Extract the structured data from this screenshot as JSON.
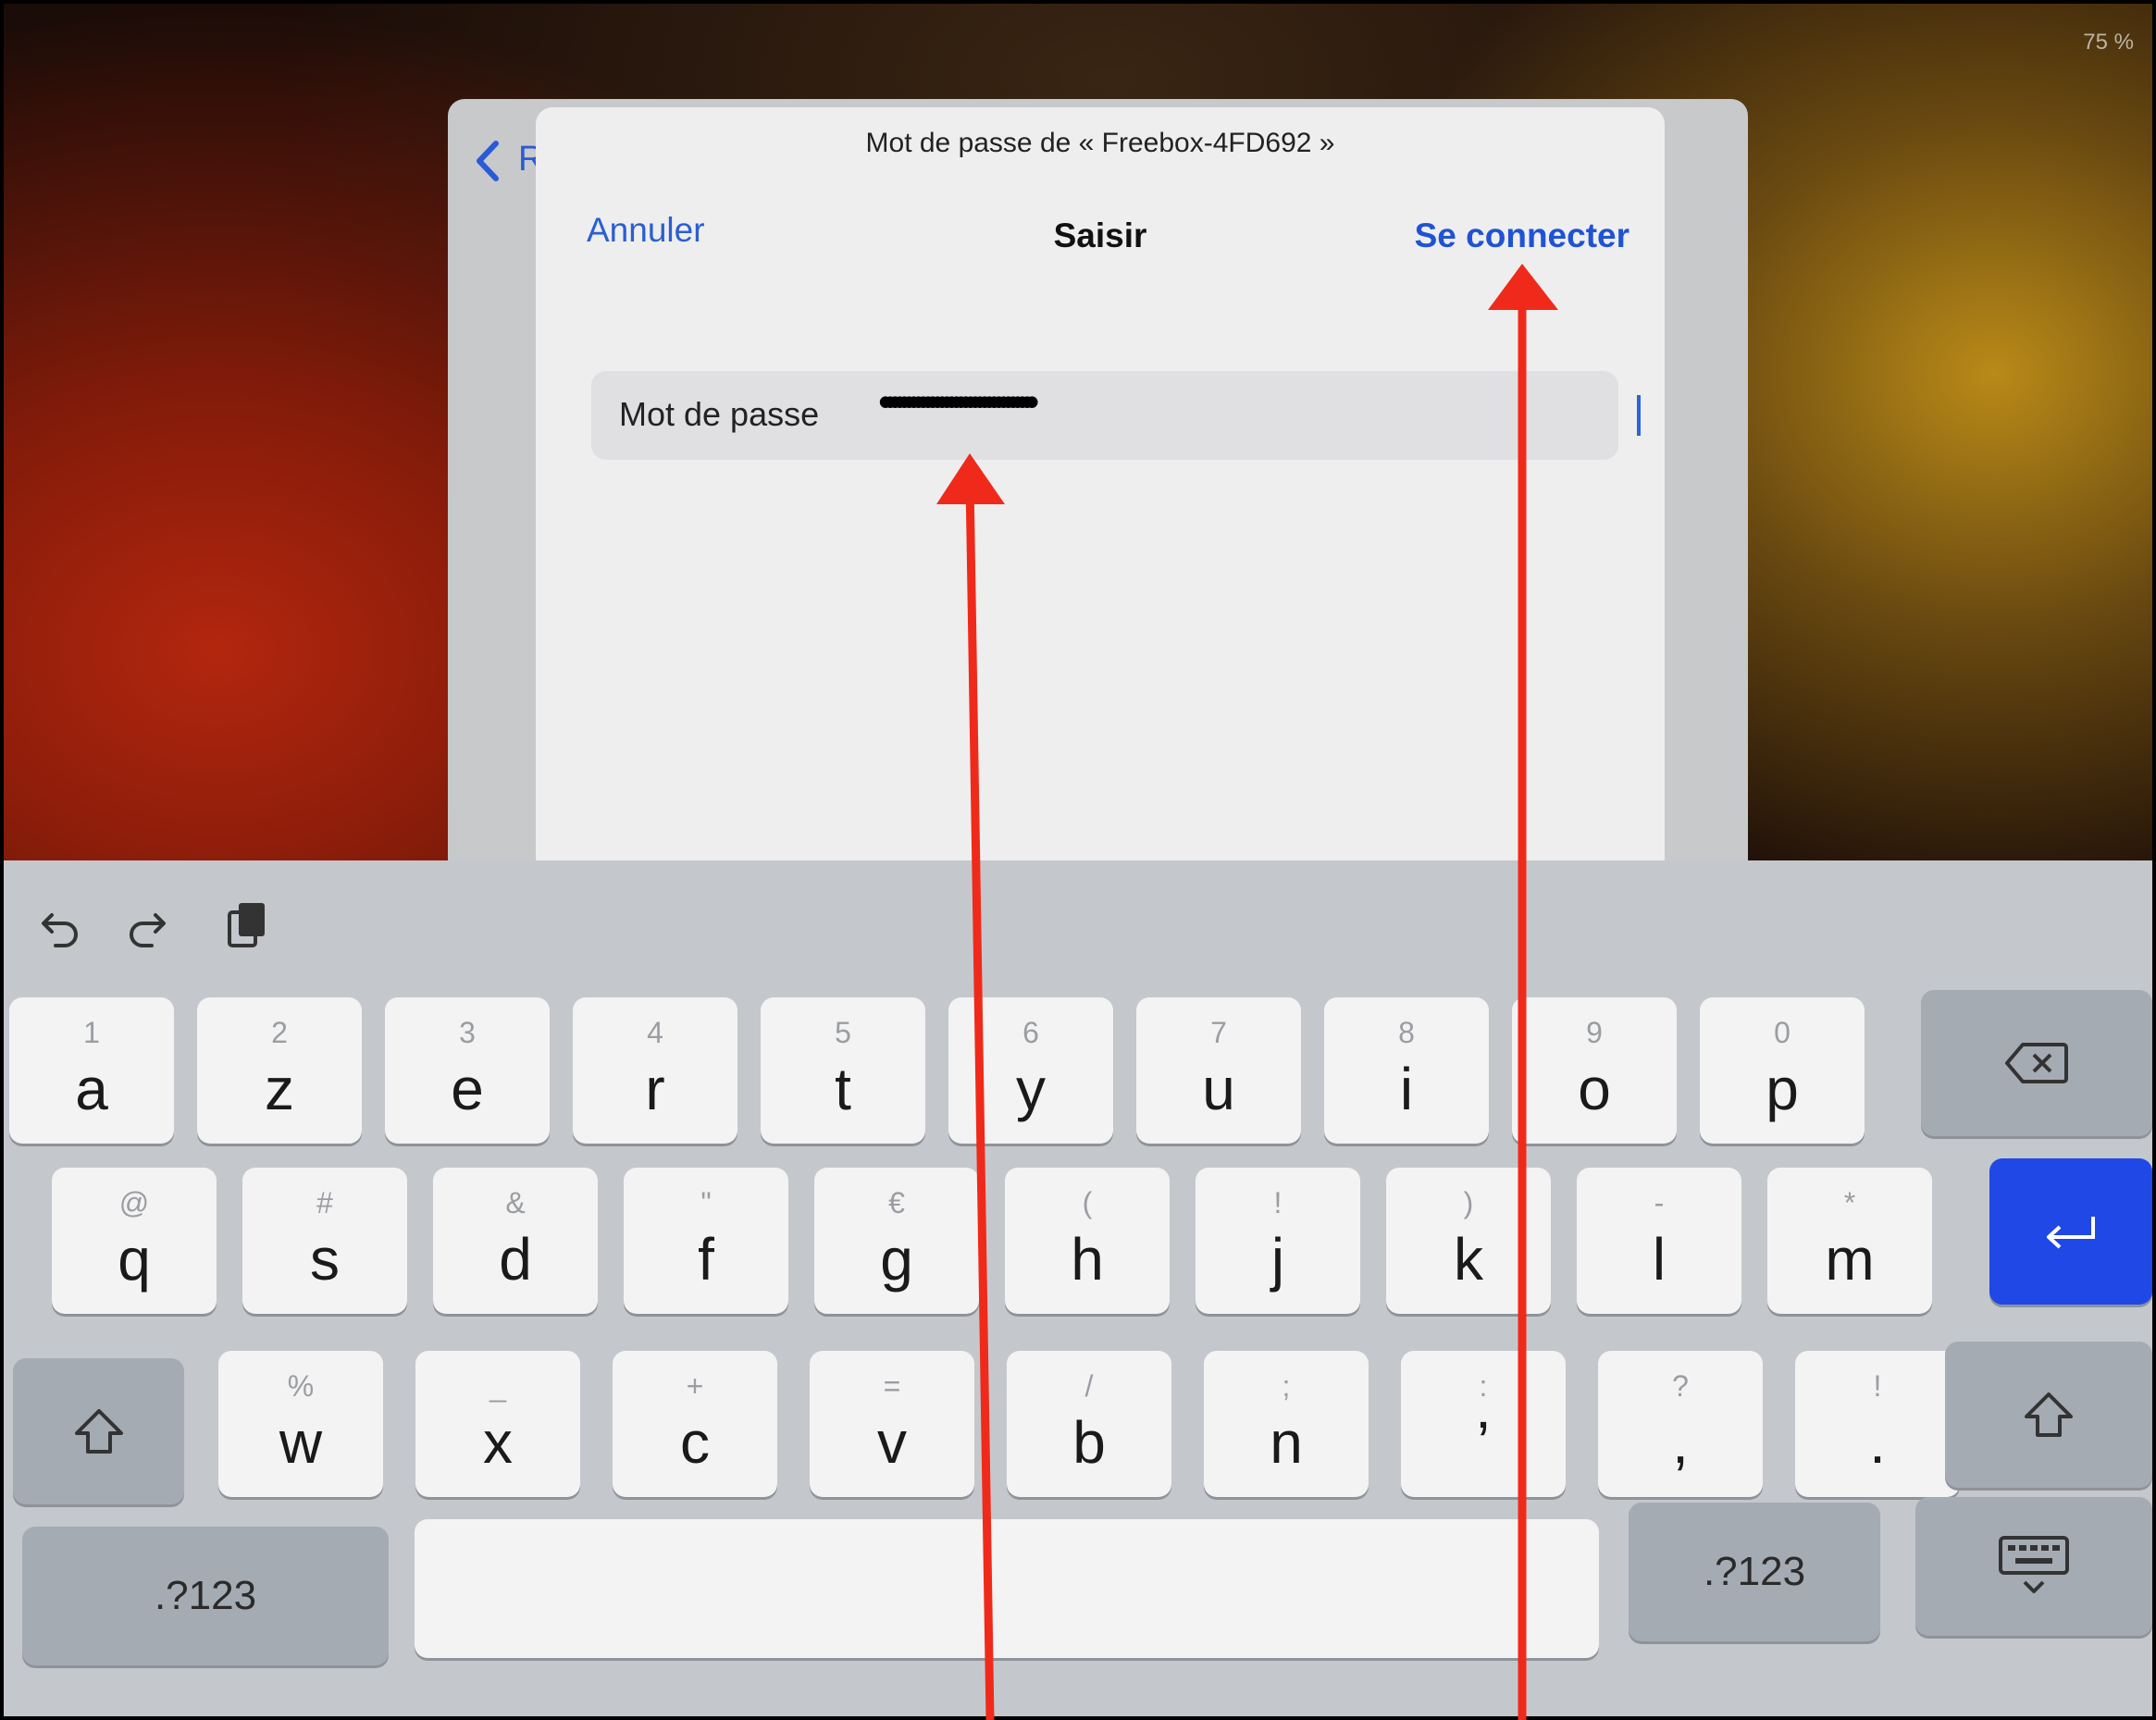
{
  "status_bar": {
    "battery": "75 %"
  },
  "back_sheet": {
    "back_label": "R"
  },
  "dialog": {
    "title": "Mot de passe de « Freebox-4FD692 »",
    "cancel_label": "Annuler",
    "nav_title": "Saisir",
    "connect_label": "Se connecter",
    "password_label": "Mot de passe",
    "password_value": "••••••••••••••••••••••••••••••••"
  },
  "keyboard": {
    "toolbar": [
      "undo-icon",
      "redo-icon",
      "paste-icon"
    ],
    "row1": [
      {
        "sec": "1",
        "key": "a"
      },
      {
        "sec": "2",
        "key": "z"
      },
      {
        "sec": "3",
        "key": "e"
      },
      {
        "sec": "4",
        "key": "r"
      },
      {
        "sec": "5",
        "key": "t"
      },
      {
        "sec": "6",
        "key": "y"
      },
      {
        "sec": "7",
        "key": "u"
      },
      {
        "sec": "8",
        "key": "i"
      },
      {
        "sec": "9",
        "key": "o"
      },
      {
        "sec": "0",
        "key": "p"
      }
    ],
    "row2": [
      {
        "sec": "@",
        "key": "q"
      },
      {
        "sec": "#",
        "key": "s"
      },
      {
        "sec": "&",
        "key": "d"
      },
      {
        "sec": "\"",
        "key": "f"
      },
      {
        "sec": "€",
        "key": "g"
      },
      {
        "sec": "(",
        "key": "h"
      },
      {
        "sec": "!",
        "key": "j"
      },
      {
        "sec": ")",
        "key": "k"
      },
      {
        "sec": "-",
        "key": "l"
      },
      {
        "sec": "*",
        "key": "m"
      }
    ],
    "row3": [
      {
        "sec": "%",
        "key": "w"
      },
      {
        "sec": "_",
        "key": "x"
      },
      {
        "sec": "+",
        "key": "c"
      },
      {
        "sec": "=",
        "key": "v"
      },
      {
        "sec": "/",
        "key": "b"
      },
      {
        "sec": ";",
        "key": "n"
      },
      {
        "sec": ":",
        "key": "’"
      },
      {
        "sec": "?",
        "key": ","
      },
      {
        "sec": "!",
        "key": "."
      }
    ],
    "numbers_label_left": ".?123",
    "numbers_label_right": ".?123",
    "space_label": ""
  },
  "colors": {
    "accent_blue": "#1f53d4",
    "return_key": "#1f48e6",
    "annotation_arrow": "#f02a1a"
  }
}
